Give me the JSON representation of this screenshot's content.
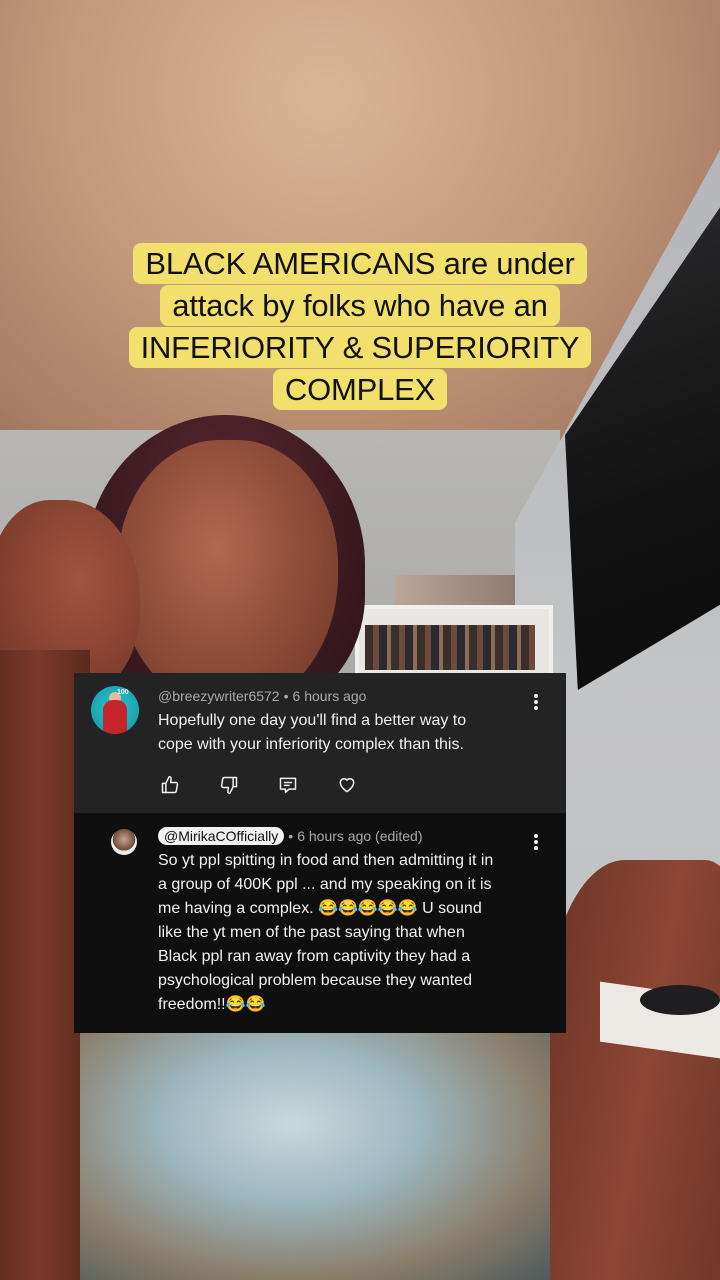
{
  "caption": {
    "line1": "BLACK AMERICANS are under",
    "line2": "attack by folks who have an",
    "line3": "INFERIORITY & SUPERIORITY",
    "line4": "COMPLEX",
    "highlight_color": "#f3df6b"
  },
  "comments": {
    "parent": {
      "handle": "@breezywriter6572",
      "time": "6 hours ago",
      "text_line1": "Hopefully one day you'll find a better way to",
      "text_line2": "cope with your inferiority complex than this.",
      "avatar_badge": "100",
      "actions": [
        "like-icon",
        "dislike-icon",
        "reply-icon",
        "heart-icon"
      ]
    },
    "reply": {
      "handle": "@MirikaCOfficially",
      "time": "6 hours ago (edited)",
      "lines": [
        "So yt ppl spitting in food and then admitting it in",
        "a group of 400K ppl ... and my speaking on it is",
        "me having a complex. 😂😂😂😂😂 U sound",
        "like the yt men of the past saying that when",
        "Black ppl ran away from captivity they had a",
        "psychological problem because they wanted",
        "freedom!!😂😂"
      ]
    }
  },
  "colors": {
    "card_top": "#232323",
    "card_bottom": "#0f0f0f",
    "meta_text": "#aaaaaa",
    "body_text": "#f1f1f1"
  }
}
